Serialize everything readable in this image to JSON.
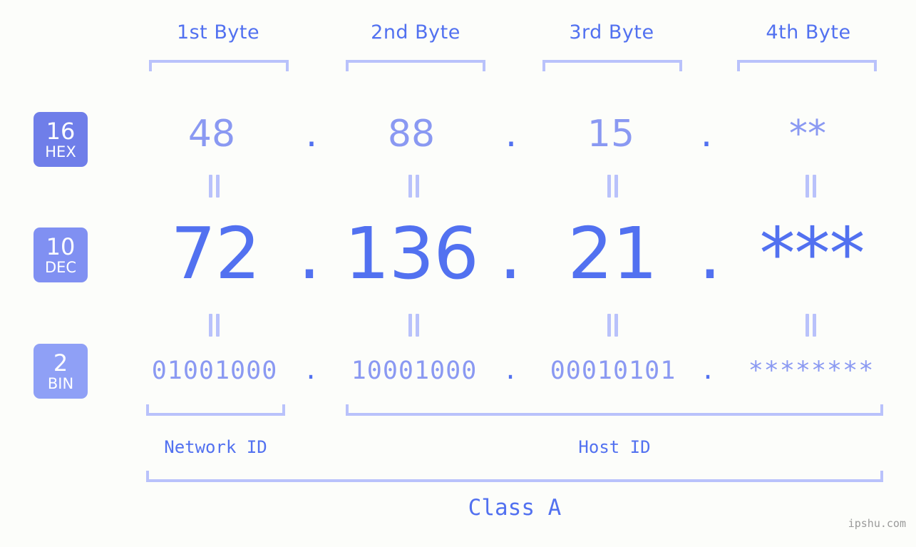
{
  "background_color": "#fcfdfa",
  "colors": {
    "accent_strong": "#5271f0",
    "accent_light": "#8a99f2",
    "bracket": "#b9c2fb",
    "badge_hex": "#6f7ee9",
    "badge_dec": "#8090f2",
    "badge_bin": "#8fa0f6",
    "watermark": "#9a9a9a"
  },
  "byte_headers": [
    {
      "label": "1st Byte"
    },
    {
      "label": "2nd Byte"
    },
    {
      "label": "3rd Byte"
    },
    {
      "label": "4th Byte"
    }
  ],
  "base_badges": [
    {
      "number": "16",
      "name": "HEX"
    },
    {
      "number": "10",
      "name": "DEC"
    },
    {
      "number": "2",
      "name": "BIN"
    }
  ],
  "rows": {
    "hex": {
      "base_number": "16",
      "base_name": "HEX",
      "values": [
        "48",
        "88",
        "15",
        "**"
      ],
      "separator": "."
    },
    "dec": {
      "base_number": "10",
      "base_name": "DEC",
      "values": [
        "72",
        "136",
        "21",
        "***"
      ],
      "separator": "."
    },
    "bin": {
      "base_number": "2",
      "base_name": "BIN",
      "values": [
        "01001000",
        "10001000",
        "00010101",
        "********"
      ],
      "separator": "."
    }
  },
  "equals_marks": {
    "symbol": "=",
    "count_per_row_gap": 4,
    "rows": 2
  },
  "id_sections": [
    {
      "label": "Network ID"
    },
    {
      "label": "Host ID"
    }
  ],
  "class_label": "Class A",
  "watermark": "ipshu.com"
}
